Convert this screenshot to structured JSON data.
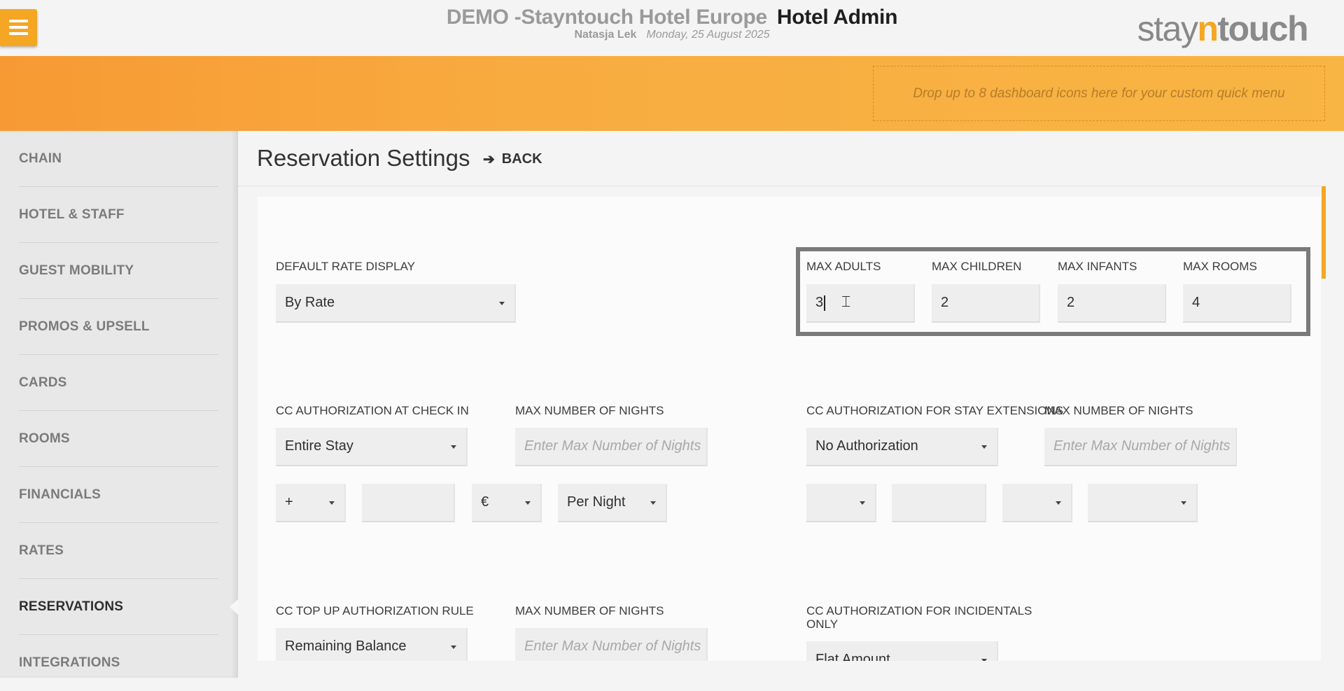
{
  "header": {
    "hotel_name": "DEMO -Stayntouch Hotel Europe",
    "app_name": "Hotel Admin",
    "user_name": "Natasja Lek",
    "date": "Monday, 25 August 2025",
    "logo": {
      "part1": "stay",
      "part2": "n",
      "part3": "touch"
    }
  },
  "quick_menu": {
    "placeholder": "Drop up to 8 dashboard icons here for your custom quick menu"
  },
  "sidebar": {
    "items": [
      {
        "label": "CHAIN"
      },
      {
        "label": "HOTEL & STAFF"
      },
      {
        "label": "GUEST MOBILITY"
      },
      {
        "label": "PROMOS & UPSELL"
      },
      {
        "label": "CARDS"
      },
      {
        "label": "ROOMS"
      },
      {
        "label": "FINANCIALS"
      },
      {
        "label": "RATES"
      },
      {
        "label": "RESERVATIONS",
        "active": true
      },
      {
        "label": "INTEGRATIONS"
      }
    ]
  },
  "page": {
    "title": "Reservation Settings",
    "back_label": "BACK"
  },
  "form": {
    "default_rate_display": {
      "label": "DEFAULT RATE DISPLAY",
      "value": "By Rate"
    },
    "max_adults": {
      "label": "MAX ADULTS",
      "value": "3"
    },
    "max_children": {
      "label": "MAX CHILDREN",
      "value": "2"
    },
    "max_infants": {
      "label": "MAX INFANTS",
      "value": "2"
    },
    "max_rooms": {
      "label": "MAX ROOMS",
      "value": "4"
    },
    "cc_auth_check_in": {
      "label": "CC AUTHORIZATION AT CHECK IN",
      "value": "Entire Stay"
    },
    "max_nights_1": {
      "label": "MAX NUMBER OF NIGHTS",
      "placeholder": "Enter Max Number of Nights"
    },
    "cc_auth_stay_ext": {
      "label": "CC AUTHORIZATION FOR STAY EXTENSIONS",
      "value": "No Authorization"
    },
    "max_nights_2": {
      "label": "MAX NUMBER OF NIGHTS",
      "placeholder": "Enter Max Number of Nights"
    },
    "check_in_row": {
      "operator": "+",
      "amount": "",
      "currency": "€",
      "per": "Per Night"
    },
    "stay_ext_row": {
      "operator": "",
      "amount": "",
      "currency": "",
      "per": ""
    },
    "cc_topup_rule": {
      "label": "CC TOP UP AUTHORIZATION RULE",
      "value": "Remaining Balance"
    },
    "max_nights_3": {
      "label": "MAX NUMBER OF NIGHTS",
      "placeholder": "Enter Max Number of Nights"
    },
    "cc_auth_incidentals": {
      "label_line1": "CC AUTHORIZATION FOR INCIDENTALS",
      "label_line2": "ONLY",
      "value": "Flat Amount"
    }
  },
  "colors": {
    "accent": "#f5a623",
    "highlight_border": "#7a7a7a"
  },
  "icons": {
    "menu": "hamburger-icon",
    "back": "arrow-left-icon",
    "cursor": "text-cursor-icon"
  }
}
